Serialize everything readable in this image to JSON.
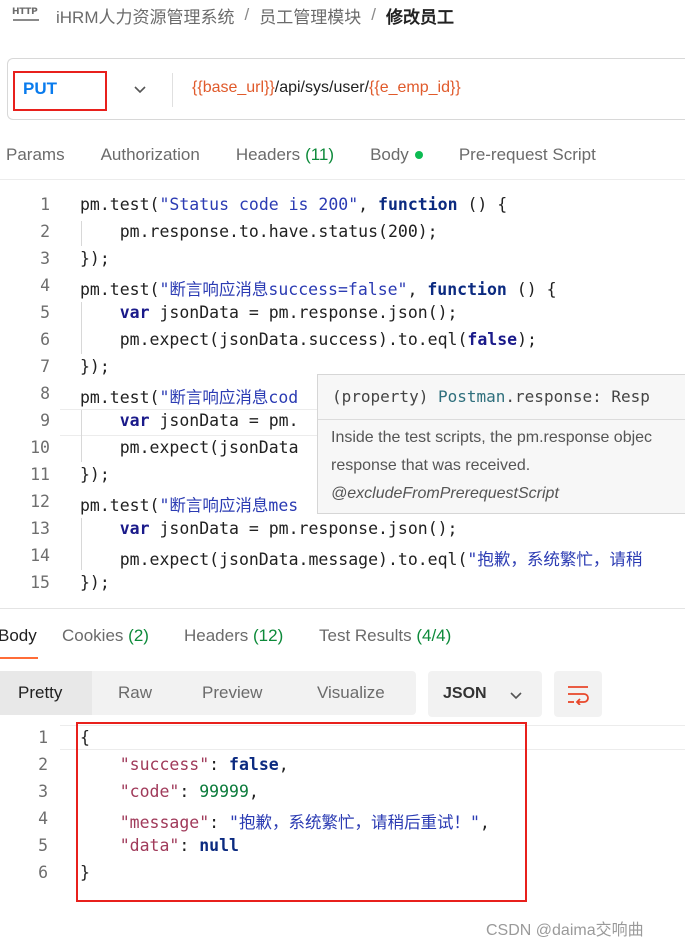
{
  "header": {
    "breadcrumb": [
      "iHRM人力资源管理系统",
      "员工管理模块",
      "修改员工"
    ],
    "icon": "http-icon"
  },
  "request": {
    "method": "PUT",
    "url_parts": {
      "base_var": "{{base_url}}",
      "path": "/api/sys/user/",
      "id_var": "{{e_emp_id}}"
    }
  },
  "request_tabs": [
    {
      "label": "Params",
      "count": ""
    },
    {
      "label": "Authorization",
      "count": ""
    },
    {
      "label": "Headers",
      "count": "(11)"
    },
    {
      "label": "Body",
      "count": ""
    },
    {
      "label": "Pre-request Script",
      "count": ""
    }
  ],
  "editor": {
    "line_numbers": [
      "1",
      "2",
      "3",
      "4",
      "5",
      "6",
      "7",
      "8",
      "9",
      "10",
      "11",
      "12",
      "13",
      "14",
      "15"
    ],
    "lines": [
      [
        [
          "n",
          "pm.test("
        ],
        [
          "s",
          "\"Status code is 200\""
        ],
        [
          "n",
          ", "
        ],
        [
          "k",
          "function"
        ],
        [
          "n",
          " () {"
        ]
      ],
      [
        [
          "n",
          "    pm.response.to.have.status(200);"
        ]
      ],
      [
        [
          "n",
          "});"
        ]
      ],
      [
        [
          "n",
          "pm.test("
        ],
        [
          "s",
          "\"断言响应消息success=false\""
        ],
        [
          "n",
          ", "
        ],
        [
          "k",
          "function"
        ],
        [
          "n",
          " () {"
        ]
      ],
      [
        [
          "kb",
          "    var"
        ],
        [
          "n",
          " jsonData = pm.response.json();"
        ]
      ],
      [
        [
          "n",
          "    pm.expect(jsonData.success).to.eql("
        ],
        [
          "kb",
          "false"
        ],
        [
          "n",
          ");"
        ]
      ],
      [
        [
          "n",
          "});"
        ]
      ],
      [
        [
          "n",
          "pm.test("
        ],
        [
          "s",
          "\"断言响应消息cod"
        ]
      ],
      [
        [
          "kb",
          "    var"
        ],
        [
          "n",
          " jsonData = pm."
        ]
      ],
      [
        [
          "n",
          "    pm.expect(jsonData"
        ]
      ],
      [
        [
          "n",
          "});"
        ]
      ],
      [
        [
          "n",
          "pm.test("
        ],
        [
          "s",
          "\"断言响应消息mes"
        ]
      ],
      [
        [
          "kb",
          "    var"
        ],
        [
          "n",
          " jsonData = pm.response.json();"
        ]
      ],
      [
        [
          "n",
          "    pm.expect(jsonData.message).to.eql("
        ],
        [
          "s",
          "\"抱歉，系统繁忙，请稍"
        ]
      ],
      [
        [
          "n",
          "});"
        ]
      ]
    ]
  },
  "tooltip": {
    "signature_prefix": "(property) ",
    "signature_type": "Postman",
    "signature_rest": ".response: Resp",
    "description_1": "Inside the test scripts, the pm.response objec",
    "description_2": "response that was received.",
    "tag": "@excludeFromPrerequestScript"
  },
  "response_tabs": [
    {
      "label": "Body",
      "count": ""
    },
    {
      "label": "Cookies",
      "count": "(2)"
    },
    {
      "label": "Headers",
      "count": "(12)"
    },
    {
      "label": "Test Results",
      "count": "(4/4)"
    }
  ],
  "view_modes": [
    "Pretty",
    "Raw",
    "Preview",
    "Visualize"
  ],
  "format": "JSON",
  "response_body": {
    "line_numbers": [
      "1",
      "2",
      "3",
      "4",
      "5",
      "6"
    ],
    "lines": [
      [
        [
          "n",
          "{"
        ]
      ],
      [
        [
          "jk",
          "    \"success\""
        ],
        [
          "n",
          ": "
        ],
        [
          "jv-b",
          "false"
        ],
        [
          "n",
          ","
        ]
      ],
      [
        [
          "jk",
          "    \"code\""
        ],
        [
          "n",
          ": "
        ],
        [
          "jv-n",
          "99999"
        ],
        [
          "n",
          ","
        ]
      ],
      [
        [
          "jk",
          "    \"message\""
        ],
        [
          "n",
          ": "
        ],
        [
          "jv-s",
          "\"抱歉，系统繁忙，请稍后重试！\""
        ],
        [
          "n",
          ","
        ]
      ],
      [
        [
          "jk",
          "    \"data\""
        ],
        [
          "n",
          ": "
        ],
        [
          "jv-b",
          "null"
        ]
      ],
      [
        [
          "n",
          "}"
        ]
      ]
    ]
  },
  "watermark": "CSDN @daima交响曲",
  "colors": {
    "method": "#097bed",
    "variable": "#e05a2b",
    "highlight_box": "#e8201c",
    "active_tab_underline": "#ff6c37",
    "count_green": "#0d8a3a"
  }
}
